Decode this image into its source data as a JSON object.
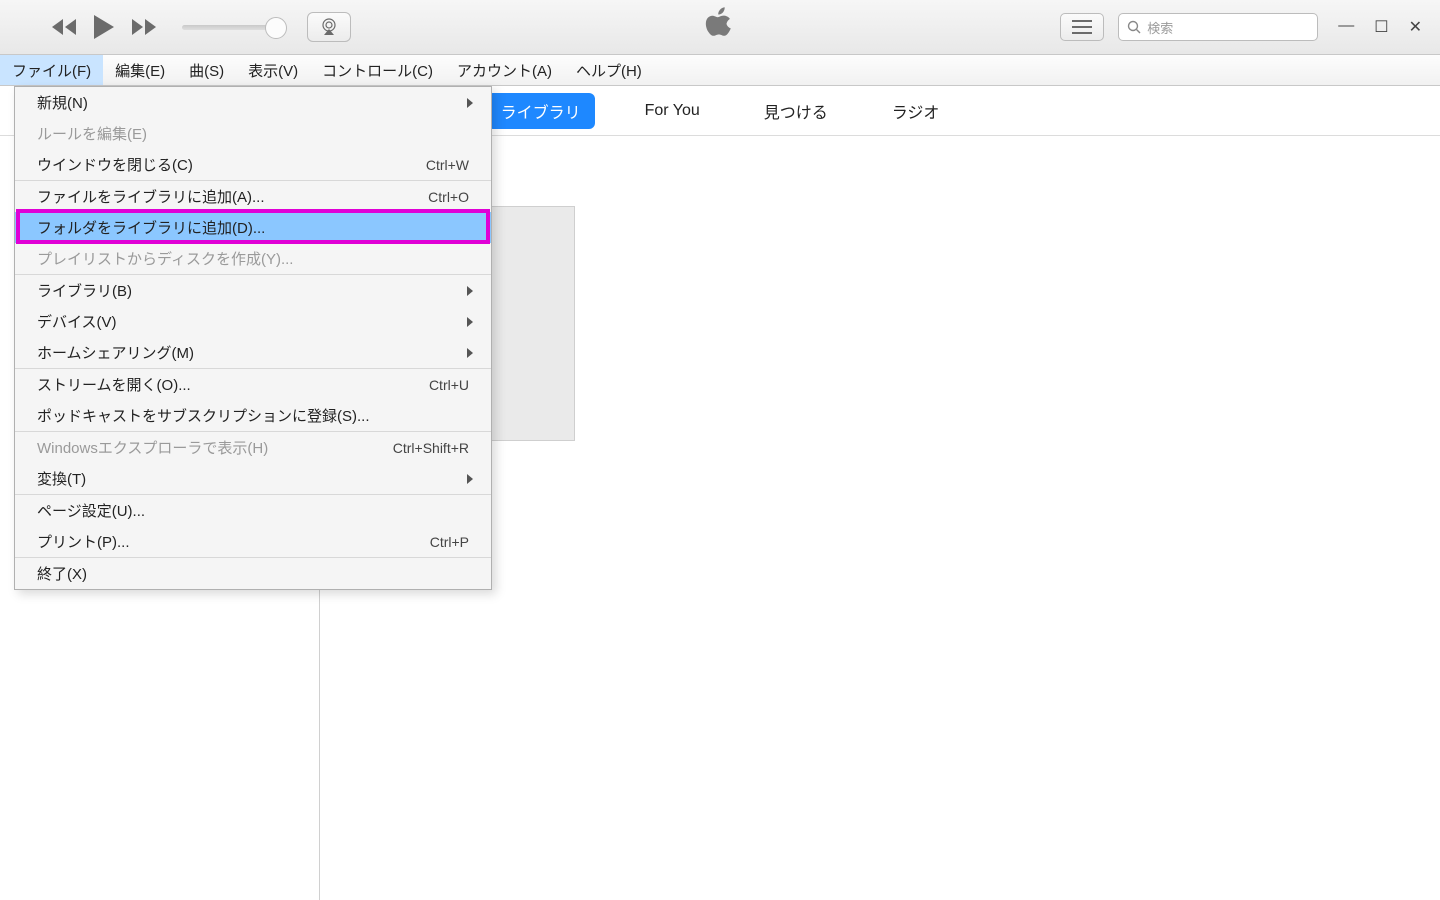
{
  "search": {
    "placeholder": "検索"
  },
  "menubar": {
    "items": [
      {
        "label": "ファイル(F)",
        "open": true
      },
      {
        "label": "編集(E)"
      },
      {
        "label": "曲(S)"
      },
      {
        "label": "表示(V)"
      },
      {
        "label": "コントロール(C)"
      },
      {
        "label": "アカウント(A)"
      },
      {
        "label": "ヘルプ(H)"
      }
    ]
  },
  "tabs": {
    "items": [
      {
        "label": "ライブラリ",
        "active": true
      },
      {
        "label": "For You"
      },
      {
        "label": "見つける"
      },
      {
        "label": "ラジオ"
      }
    ]
  },
  "file_menu": {
    "groups": [
      [
        {
          "label": "新規(N)",
          "submenu": true
        },
        {
          "label": "ルールを編集(E)",
          "disabled": true
        },
        {
          "label": "ウインドウを閉じる(C)",
          "shortcut": "Ctrl+W"
        }
      ],
      [
        {
          "label": "ファイルをライブラリに追加(A)...",
          "shortcut": "Ctrl+O"
        },
        {
          "label": "フォルダをライブラリに追加(D)...",
          "highlight": true
        },
        {
          "label": "プレイリストからディスクを作成(Y)...",
          "disabled": true
        }
      ],
      [
        {
          "label": "ライブラリ(B)",
          "submenu": true
        },
        {
          "label": "デバイス(V)",
          "submenu": true
        },
        {
          "label": "ホームシェアリング(M)",
          "submenu": true
        }
      ],
      [
        {
          "label": "ストリームを開く(O)...",
          "shortcut": "Ctrl+U"
        },
        {
          "label": "ポッドキャストをサブスクリプションに登録(S)..."
        }
      ],
      [
        {
          "label": "Windowsエクスプローラで表示(H)",
          "shortcut": "Ctrl+Shift+R",
          "disabled": true
        },
        {
          "label": "変換(T)",
          "submenu": true
        }
      ],
      [
        {
          "label": "ページ設定(U)..."
        },
        {
          "label": "プリント(P)...",
          "shortcut": "Ctrl+P"
        }
      ],
      [
        {
          "label": "終了(X)"
        }
      ]
    ]
  }
}
